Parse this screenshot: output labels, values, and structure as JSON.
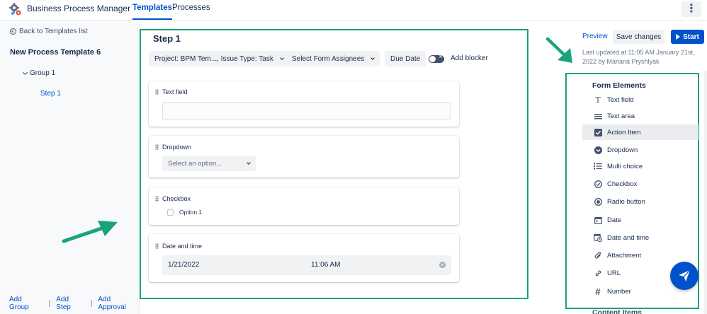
{
  "app": {
    "title": "Business Process Manager"
  },
  "nav": {
    "tabs": [
      {
        "label": "Templates",
        "active": true
      },
      {
        "label": "Processes",
        "active": false
      }
    ],
    "more_icon": "kebab-icon"
  },
  "sidebar": {
    "back_label": "Back to Templates list",
    "template_name": "New Process Template 6",
    "group_label": "Group 1",
    "step_label": "Step 1",
    "footer": {
      "add_group": "Add Group",
      "add_step": "Add Step",
      "add_approval": "Add Approval"
    }
  },
  "step": {
    "title": "Step 1",
    "project_chip": "Project: BPM Tem..., Issue Type: Task",
    "assignees_chip": "Select Form Assignees",
    "due_date_chip": "Due Date",
    "blocker_label": "Add blocker",
    "fields": {
      "text_field": {
        "label": "Text field",
        "value": ""
      },
      "dropdown": {
        "label": "Dropdown",
        "placeholder": "Select an option..."
      },
      "checkbox": {
        "label": "Checkbox",
        "option": "Option 1"
      },
      "datetime": {
        "label": "Date and time",
        "date": "1/21/2022",
        "time": "11:06 AM"
      }
    }
  },
  "toolbar": {
    "preview_label": "Preview",
    "save_label": "Save changes",
    "start_label": "Start",
    "last_updated": "Last updated at 11:05 AM January 21st, 2022 by Mariana Pryshlyak"
  },
  "form_elements": {
    "title": "Form Elements",
    "items": [
      {
        "label": "Text field",
        "icon": "text-field-icon"
      },
      {
        "label": "Text area",
        "icon": "text-area-icon"
      },
      {
        "label": "Action Item",
        "icon": "action-item-icon",
        "selected": true
      },
      {
        "label": "Dropdown",
        "icon": "dropdown-icon"
      },
      {
        "label": "Multi choice",
        "icon": "multi-choice-icon"
      },
      {
        "label": "Checkbox",
        "icon": "checkbox-icon"
      },
      {
        "label": "Radio button",
        "icon": "radio-button-icon"
      },
      {
        "label": "Date",
        "icon": "date-icon"
      },
      {
        "label": "Date and time",
        "icon": "date-time-icon"
      },
      {
        "label": "Attachment",
        "icon": "attachment-icon"
      },
      {
        "label": "URL",
        "icon": "url-icon"
      },
      {
        "label": "Number",
        "icon": "number-icon"
      }
    ],
    "next_section_partial": "Content Items"
  },
  "colors": {
    "accent": "#0052cc",
    "highlight_outline": "#1aa37a",
    "arrow": "#1aa37a"
  }
}
